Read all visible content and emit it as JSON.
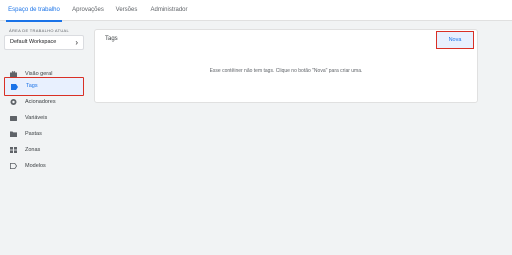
{
  "tabs": [
    {
      "label": "Espaço de trabalho",
      "active": true
    },
    {
      "label": "Aprovações"
    },
    {
      "label": "Versões"
    },
    {
      "label": "Administrador"
    }
  ],
  "workspace": {
    "caption": "ÁREA DE TRABALHO ATUAL",
    "name": "Default Workspace"
  },
  "sidebar": {
    "items": [
      {
        "label": "Visão geral",
        "icon": "briefcase-icon"
      },
      {
        "label": "Tags",
        "icon": "tag-icon",
        "selected": true
      },
      {
        "label": "Acionadores",
        "icon": "trigger-icon"
      },
      {
        "label": "Variáveis",
        "icon": "variables-icon"
      },
      {
        "label": "Pastas",
        "icon": "folder-icon"
      },
      {
        "label": "Zonas",
        "icon": "zones-icon"
      },
      {
        "label": "Modelos",
        "icon": "template-icon"
      }
    ]
  },
  "main": {
    "title": "Tags",
    "new_button": "Nova",
    "empty_message": "Esse contêiner não tem tags. Clique no botão \"Nova\" para criar uma."
  },
  "colors": {
    "accent": "#1a73e8",
    "highlight_border": "#d93025",
    "selected_bg": "#e8f0fe"
  }
}
